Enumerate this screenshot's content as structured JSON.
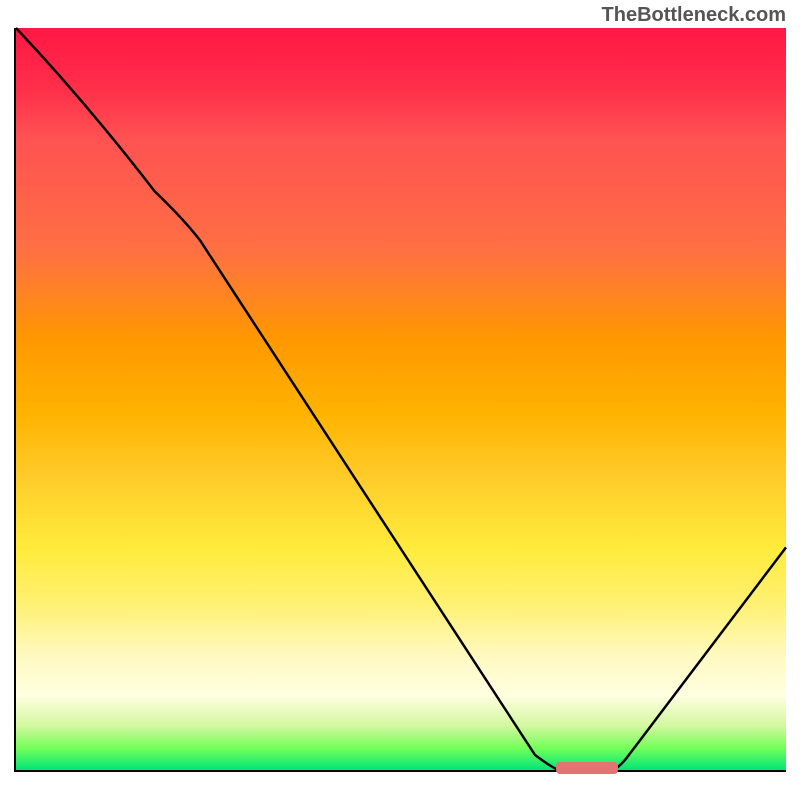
{
  "watermark": "TheBottleneck.com",
  "chart_data": {
    "type": "line",
    "title": "",
    "xlabel": "",
    "ylabel": "",
    "xlim": [
      0,
      100
    ],
    "ylim": [
      0,
      100
    ],
    "series": [
      {
        "name": "curve",
        "x": [
          0,
          18,
          22,
          70,
          78,
          100
        ],
        "y": [
          100,
          78,
          74,
          0,
          0,
          30
        ]
      }
    ],
    "marker": {
      "x_start": 70,
      "x_end": 78,
      "y": 0
    },
    "gradient": {
      "top": "#ff1744",
      "mid": "#ffeb3b",
      "bottom": "#00e676"
    }
  }
}
